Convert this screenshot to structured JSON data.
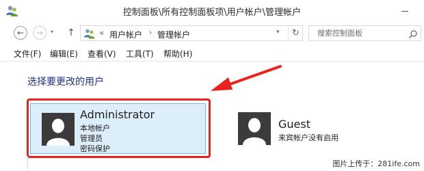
{
  "window": {
    "title": "控制面板\\所有控制面板项\\用户帐户\\管理帐户"
  },
  "toolbar": {
    "back_glyph": "←",
    "forward_glyph": "→",
    "recent_glyph": "▾",
    "up_glyph": "↑",
    "address": {
      "overflow_glyph": "«",
      "crumbs": [
        "用户帐户",
        "管理帐户"
      ],
      "separator_glyph": "›",
      "dropdown_glyph": "▾",
      "refresh_glyph": "↻"
    },
    "search": {
      "placeholder": "搜索控制面板"
    }
  },
  "menu": {
    "items": [
      "文件(F)",
      "编辑(E)",
      "查看(V)",
      "工具(T)",
      "帮助(H)"
    ]
  },
  "main": {
    "heading": "选择要更改的用户",
    "users": [
      {
        "name": "Administrator",
        "details": [
          "本地帐户",
          "管理员",
          "密码保护"
        ],
        "selected": true,
        "avatar_icon": "user-silhouette-icon"
      },
      {
        "name": "Guest",
        "details": [
          "来宾帐户没有启用"
        ],
        "selected": false,
        "avatar_icon": "user-silhouette-icon"
      }
    ]
  },
  "annotation": {
    "highlight_color": "#e8231f"
  },
  "watermark": {
    "text": "图片上传于：281ife.com"
  },
  "colors": {
    "heading": "#1e3287",
    "selection_fill": "#ddeefb",
    "selection_border": "#75b8e6"
  }
}
